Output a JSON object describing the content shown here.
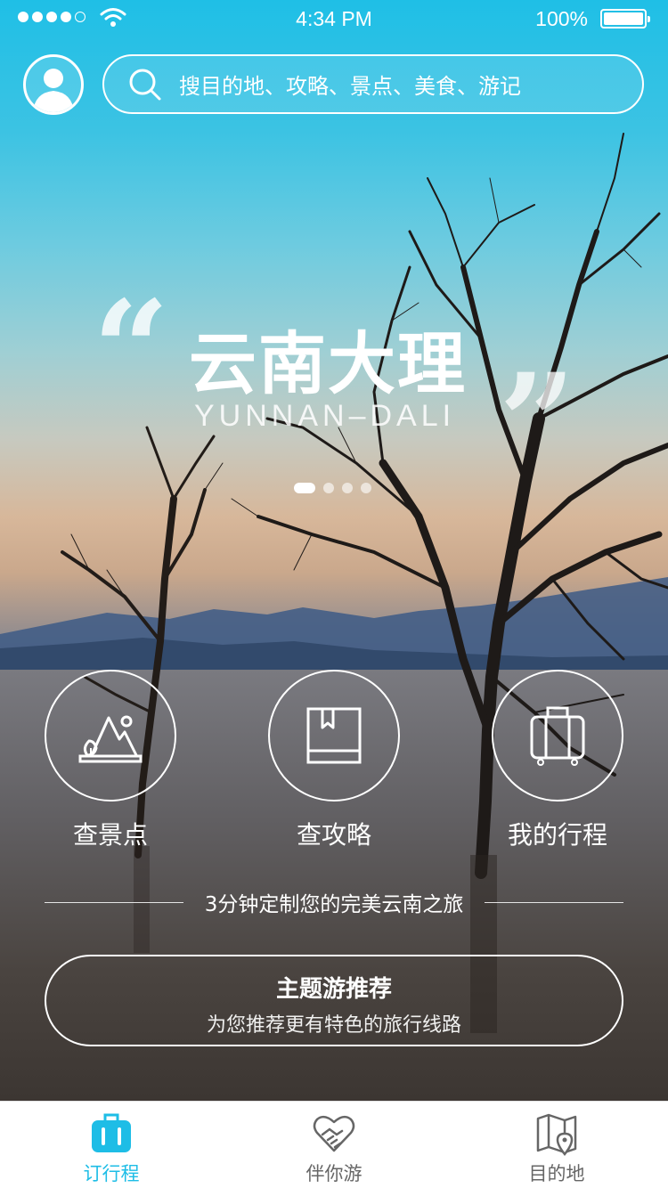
{
  "status_bar": {
    "time": "4:34 PM",
    "battery": "100%"
  },
  "header": {
    "search_placeholder": "搜目的地、攻略、景点、美食、游记"
  },
  "hero": {
    "title": "云南大理",
    "subtitle": "YUNNAN–DALI",
    "quote_open": "“",
    "quote_close": "”",
    "carousel_pages": 4,
    "carousel_active": 1
  },
  "quick_actions": [
    {
      "label": "查景点",
      "icon": "landscape-icon"
    },
    {
      "label": "查攻略",
      "icon": "book-icon"
    },
    {
      "label": "我的行程",
      "icon": "luggage-icon"
    }
  ],
  "tagline": "3分钟定制您的完美云南之旅",
  "theme_button": {
    "title": "主题游推荐",
    "subtitle": "为您推荐更有特色的旅行线路"
  },
  "tab_bar": [
    {
      "label": "订行程",
      "icon": "suitcase-icon",
      "active": true
    },
    {
      "label": "伴你游",
      "icon": "heart-handshake-icon",
      "active": false
    },
    {
      "label": "目的地",
      "icon": "map-pin-icon",
      "active": false
    }
  ],
  "colors": {
    "accent": "#1ebde6",
    "tab_inactive": "#666666"
  }
}
